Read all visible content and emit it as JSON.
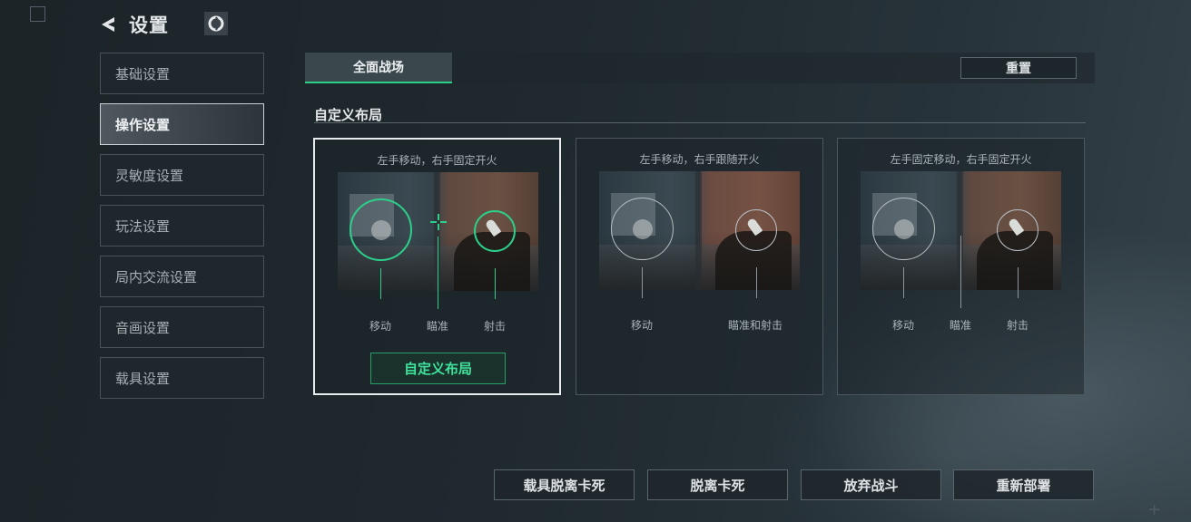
{
  "header": {
    "title": "设置",
    "back_icon": "back-arrow-icon",
    "logo_icon": "game-logo-icon"
  },
  "sidebar": {
    "items": [
      {
        "label": "基础设置",
        "active": false
      },
      {
        "label": "操作设置",
        "active": true
      },
      {
        "label": "灵敏度设置",
        "active": false
      },
      {
        "label": "玩法设置",
        "active": false
      },
      {
        "label": "局内交流设置",
        "active": false
      },
      {
        "label": "音画设置",
        "active": false
      },
      {
        "label": "载具设置",
        "active": false
      }
    ]
  },
  "tabs": {
    "active_label": "全面战场",
    "reset_label": "重置"
  },
  "section": {
    "title": "自定义布局"
  },
  "layouts": [
    {
      "caption": "左手移动，右手固定开火",
      "labels": [
        "移动",
        "瞄准",
        "射击"
      ],
      "selected": true,
      "button": "自定义布局"
    },
    {
      "caption": "左手移动，右手跟随开火",
      "labels": [
        "移动",
        "瞄准和射击"
      ],
      "selected": false
    },
    {
      "caption": "左手固定移动，右手固定开火",
      "labels": [
        "移动",
        "瞄准",
        "射击"
      ],
      "selected": false
    }
  ],
  "bottom_buttons": [
    "载具脱离卡死",
    "脱离卡死",
    "放弃战斗",
    "重新部署"
  ],
  "colors": {
    "accent": "#2ccf8a",
    "accent_text": "#3ee39b",
    "selected_border": "#e9ecee"
  }
}
